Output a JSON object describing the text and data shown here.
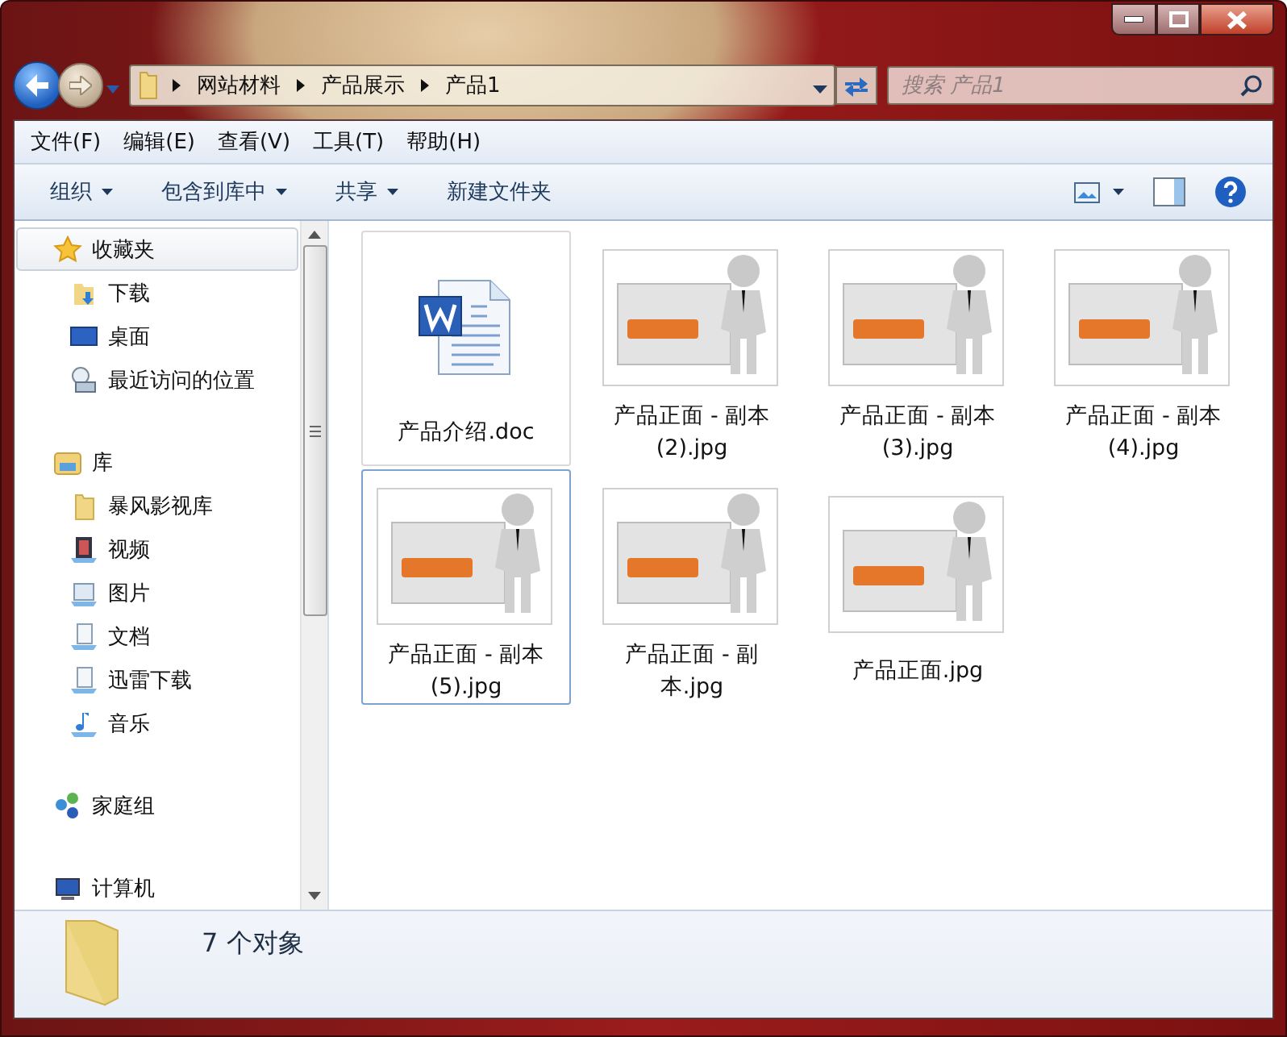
{
  "address": {
    "crumbs": [
      "网站材料",
      "产品展示",
      "产品1"
    ]
  },
  "search": {
    "placeholder": "搜索 产品1"
  },
  "menu": [
    "文件(F)",
    "编辑(E)",
    "查看(V)",
    "工具(T)",
    "帮助(H)"
  ],
  "commands": [
    {
      "label": "组织",
      "dropdown": true
    },
    {
      "label": "包含到库中",
      "dropdown": true
    },
    {
      "label": "共享",
      "dropdown": true
    },
    {
      "label": "新建文件夹",
      "dropdown": false
    }
  ],
  "sidebar": {
    "groups": [
      {
        "label": "收藏夹",
        "kind": "star",
        "selected": true,
        "children": [
          {
            "label": "下载",
            "kind": "download",
            "selected": false
          },
          {
            "label": "桌面",
            "kind": "desktop",
            "selected": false
          },
          {
            "label": "最近访问的位置",
            "kind": "recent",
            "selected": false
          }
        ]
      },
      {
        "label": "库",
        "kind": "library",
        "selected": false,
        "children": [
          {
            "label": "暴风影视库",
            "kind": "folder",
            "selected": false
          },
          {
            "label": "视频",
            "kind": "video",
            "selected": false
          },
          {
            "label": "图片",
            "kind": "picture",
            "selected": false
          },
          {
            "label": "文档",
            "kind": "document",
            "selected": false
          },
          {
            "label": "迅雷下载",
            "kind": "document",
            "selected": false
          },
          {
            "label": "音乐",
            "kind": "music",
            "selected": false
          }
        ]
      },
      {
        "label": "家庭组",
        "kind": "homegroup",
        "selected": false
      },
      {
        "label": "计算机",
        "kind": "computer",
        "selected": false
      }
    ]
  },
  "files": [
    {
      "name": "产品介绍.doc",
      "kind": "doc",
      "selected": false,
      "hot": true
    },
    {
      "name": "产品正面 - 副本 (2).jpg",
      "kind": "image",
      "selected": false,
      "hot": false
    },
    {
      "name": "产品正面 - 副本 (3).jpg",
      "kind": "image",
      "selected": false,
      "hot": false
    },
    {
      "name": "产品正面 - 副本 (4).jpg",
      "kind": "image",
      "selected": false,
      "hot": false
    },
    {
      "name": "产品正面 - 副本 (5).jpg",
      "kind": "image",
      "selected": true,
      "hot": false
    },
    {
      "name": "产品正面 - 副本.jpg",
      "kind": "image",
      "selected": false,
      "hot": false
    },
    {
      "name": "产品正面.jpg",
      "kind": "image",
      "selected": false,
      "hot": false
    }
  ],
  "status_bar": {
    "count": "7 个对象"
  }
}
